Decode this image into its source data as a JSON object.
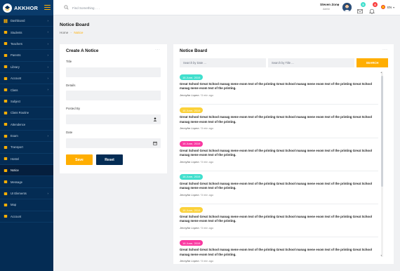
{
  "brand": {
    "name": "AKKHOR"
  },
  "sidebar": {
    "items": [
      {
        "label": "Dashboard",
        "icon": "dashboard-icon",
        "has_submenu": true
      },
      {
        "label": "Students",
        "icon": "students-icon",
        "has_submenu": true
      },
      {
        "label": "Teachers",
        "icon": "teachers-icon",
        "has_submenu": true
      },
      {
        "label": "Parents",
        "icon": "parents-icon",
        "has_submenu": true
      },
      {
        "label": "Library",
        "icon": "library-icon",
        "has_submenu": true
      },
      {
        "label": "Account",
        "icon": "account-icon",
        "has_submenu": true
      },
      {
        "label": "Class",
        "icon": "class-icon",
        "has_submenu": true
      },
      {
        "label": "Subject",
        "icon": "subject-icon",
        "has_submenu": false
      },
      {
        "label": "Class Routine",
        "icon": "routine-icon",
        "has_submenu": false
      },
      {
        "label": "Attendence",
        "icon": "attendance-icon",
        "has_submenu": false
      },
      {
        "label": "Exam",
        "icon": "exam-icon",
        "has_submenu": true
      },
      {
        "label": "Transport",
        "icon": "transport-icon",
        "has_submenu": false
      },
      {
        "label": "Hostel",
        "icon": "hostel-icon",
        "has_submenu": false
      },
      {
        "label": "Notice",
        "icon": "notice-icon",
        "has_submenu": false,
        "active": true
      },
      {
        "label": "Message",
        "icon": "message-icon",
        "has_submenu": false
      },
      {
        "label": "UI Elements",
        "icon": "ui-elements-icon",
        "has_submenu": true
      },
      {
        "label": "Map",
        "icon": "map-icon",
        "has_submenu": false
      },
      {
        "label": "Account",
        "icon": "account-settings-icon",
        "has_submenu": false
      }
    ]
  },
  "topbar": {
    "search_placeholder": "Find Something . . .",
    "user": {
      "name": "Steven Zone",
      "role": "Admin"
    },
    "messages_count": "5",
    "notifications_count": "8",
    "language": "EN"
  },
  "page": {
    "title": "Notice Board",
    "breadcrumb": {
      "home": "Home",
      "current": "Notice"
    }
  },
  "create_form": {
    "title": "Create A Notice",
    "fields": {
      "title_label": "Title",
      "details_label": "Details",
      "posted_by_label": "Posted By",
      "date_label": "Date"
    },
    "save_label": "Save",
    "reset_label": "Reset"
  },
  "notice_board": {
    "title": "Notice Board",
    "search_date_placeholder": "Search by Date ...",
    "search_title_placeholder": "Search by Title ...",
    "search_button": "SEARCH",
    "notices": [
      {
        "date": "16 June, 2019",
        "date_color": "#40dfcd",
        "text": "Great School Great School manag mene esom text of the printing Great School manag mene esom text of the printing Great School manag mene esom text of the printing.",
        "author": "Jennyfar Lopez",
        "time": "5 min ago"
      },
      {
        "date": "16 June, 2019",
        "date_color": "#fbd139",
        "text": "Great School Great School manag mene esom text of the printing Great School manag mene esom text of the printing Great School manag mene esom text of the printing.",
        "author": "Jennyfar Lopez",
        "time": "5 min ago"
      },
      {
        "date": "16 June, 2019",
        "date_color": "#f939a1",
        "text": "Great School Great School manag mene esom text of the printing Great School manag mene esom text of the printing Great School manag mene esom text of the printing.",
        "author": "Jennyfar Lopez",
        "time": "5 min ago"
      },
      {
        "date": "16 June, 2019",
        "date_color": "#40dfcd",
        "text": "Great School Great School manag mene esom text of the printing Great School manag mene esom text of the printing Great School manag mene esom text of the printing.",
        "author": "Jennyfar Lopez",
        "time": "5 min ago"
      },
      {
        "date": "16 June, 2019",
        "date_color": "#fbd139",
        "text": "Great School Great School manag mene esom text of the printing Great School manag mene esom text of the printing Great School manag mene esom text of the printing.",
        "author": "Jennyfar Lopez",
        "time": "5 min ago"
      },
      {
        "date": "16 June, 2019",
        "date_color": "#f939a1",
        "text": "Great School Great School manag mene esom text of the printing Great School manag mene esom text of the printing Great School manag mene esom text of the printing.",
        "author": "Jennyfar Lopez",
        "time": "5 min ago"
      }
    ]
  },
  "colors": {
    "sidebar": "#042c54",
    "accent": "#ffae01",
    "page_bg": "#f0f1f3"
  }
}
